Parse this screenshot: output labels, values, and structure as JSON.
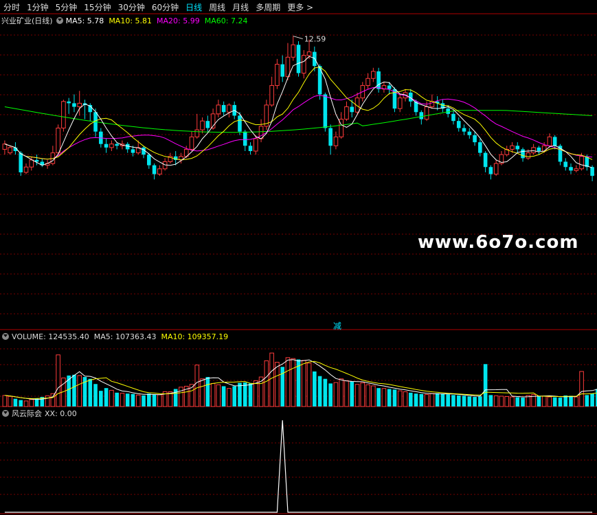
{
  "tabs": [
    "分时",
    "1分钟",
    "5分钟",
    "15分钟",
    "30分钟",
    "60分钟",
    "日线",
    "周线",
    "月线",
    "多周期",
    "更多 >"
  ],
  "active_tab": "日线",
  "colors": {
    "up": "#ff3c3c",
    "down": "#00e5ee",
    "ma5": "#ffffff",
    "ma10": "#ffff00",
    "ma20": "#ff00ff",
    "ma60": "#00ff00",
    "grid": "#7a0000",
    "border": "#b00000"
  },
  "main_panel": {
    "title": "兴业矿业(日线)",
    "indicators": [
      {
        "label": "MA5: 5.78",
        "color": "#ffffff"
      },
      {
        "label": "MA10: 5.81",
        "color": "#ffff00"
      },
      {
        "label": "MA20: 5.99",
        "color": "#ff00ff"
      },
      {
        "label": "MA60: 7.24",
        "color": "#00ff00"
      }
    ],
    "high_label": "12.59"
  },
  "volume_panel": {
    "indicators": [
      {
        "label": "VOLUME: 124535.40",
        "color": "#dddddd"
      },
      {
        "label": "MA5: 107363.43",
        "color": "#dddddd"
      },
      {
        "label": "MA10: 109357.19",
        "color": "#ffff00"
      }
    ],
    "marker": "减"
  },
  "indicator_panel": {
    "title": "风云际会",
    "value_label": "XX: 0.00"
  },
  "watermark": "www.6o7o.com",
  "chart_data": {
    "type": "candlestick",
    "price_range": [
      3.0,
      13.0
    ],
    "candles": [
      {
        "o": 6.2,
        "c": 6.5,
        "h": 6.7,
        "l": 5.9
      },
      {
        "o": 6.0,
        "c": 6.3,
        "h": 6.4,
        "l": 5.9
      },
      {
        "o": 6.3,
        "c": 6.1,
        "h": 6.6,
        "l": 5.9
      },
      {
        "o": 6.0,
        "c": 4.9,
        "h": 6.1,
        "l": 4.7
      },
      {
        "o": 4.9,
        "c": 5.2,
        "h": 5.4,
        "l": 4.8
      },
      {
        "o": 5.2,
        "c": 5.6,
        "h": 5.8,
        "l": 5.0
      },
      {
        "o": 5.6,
        "c": 5.5,
        "h": 5.9,
        "l": 5.3
      },
      {
        "o": 5.5,
        "c": 5.3,
        "h": 5.7,
        "l": 5.2
      },
      {
        "o": 5.3,
        "c": 5.4,
        "h": 5.6,
        "l": 5.1
      },
      {
        "o": 5.4,
        "c": 6.0,
        "h": 6.4,
        "l": 5.3
      },
      {
        "o": 6.0,
        "c": 7.4,
        "h": 7.6,
        "l": 5.9
      },
      {
        "o": 7.4,
        "c": 8.9,
        "h": 9.0,
        "l": 7.2
      },
      {
        "o": 8.9,
        "c": 8.8,
        "h": 9.1,
        "l": 8.2
      },
      {
        "o": 8.8,
        "c": 8.6,
        "h": 9.3,
        "l": 8.3
      },
      {
        "o": 8.6,
        "c": 8.8,
        "h": 9.5,
        "l": 8.1
      },
      {
        "o": 8.8,
        "c": 8.7,
        "h": 9.0,
        "l": 7.9
      },
      {
        "o": 8.7,
        "c": 8.3,
        "h": 8.8,
        "l": 7.8
      },
      {
        "o": 8.3,
        "c": 7.2,
        "h": 8.5,
        "l": 6.9
      },
      {
        "o": 7.2,
        "c": 6.5,
        "h": 7.4,
        "l": 6.3
      },
      {
        "o": 6.5,
        "c": 6.3,
        "h": 6.8,
        "l": 6.0
      },
      {
        "o": 6.3,
        "c": 6.5,
        "h": 6.7,
        "l": 6.1
      },
      {
        "o": 6.5,
        "c": 6.4,
        "h": 6.6,
        "l": 6.2
      },
      {
        "o": 6.4,
        "c": 6.5,
        "h": 6.7,
        "l": 6.2
      },
      {
        "o": 6.5,
        "c": 6.2,
        "h": 6.6,
        "l": 6.0
      },
      {
        "o": 6.2,
        "c": 6.0,
        "h": 6.4,
        "l": 5.8
      },
      {
        "o": 6.0,
        "c": 6.3,
        "h": 6.7,
        "l": 5.9
      },
      {
        "o": 6.3,
        "c": 5.9,
        "h": 6.4,
        "l": 5.7
      },
      {
        "o": 5.9,
        "c": 5.3,
        "h": 6.0,
        "l": 5.1
      },
      {
        "o": 5.3,
        "c": 4.8,
        "h": 5.4,
        "l": 4.5
      },
      {
        "o": 4.8,
        "c": 5.1,
        "h": 5.3,
        "l": 4.7
      },
      {
        "o": 5.1,
        "c": 5.5,
        "h": 5.7,
        "l": 5.0
      },
      {
        "o": 5.5,
        "c": 5.8,
        "h": 6.0,
        "l": 5.4
      },
      {
        "o": 5.8,
        "c": 5.6,
        "h": 6.1,
        "l": 5.3
      },
      {
        "o": 5.6,
        "c": 5.8,
        "h": 6.0,
        "l": 5.4
      },
      {
        "o": 5.8,
        "c": 6.2,
        "h": 6.4,
        "l": 5.7
      },
      {
        "o": 6.2,
        "c": 6.9,
        "h": 7.2,
        "l": 6.1
      },
      {
        "o": 6.9,
        "c": 7.3,
        "h": 8.2,
        "l": 6.8
      },
      {
        "o": 7.3,
        "c": 7.8,
        "h": 8.0,
        "l": 7.1
      },
      {
        "o": 7.8,
        "c": 7.4,
        "h": 8.1,
        "l": 7.2
      },
      {
        "o": 7.4,
        "c": 8.2,
        "h": 8.5,
        "l": 7.3
      },
      {
        "o": 8.2,
        "c": 8.7,
        "h": 9.0,
        "l": 8.0
      },
      {
        "o": 8.7,
        "c": 8.3,
        "h": 8.9,
        "l": 8.1
      },
      {
        "o": 8.3,
        "c": 8.7,
        "h": 8.8,
        "l": 8.0
      },
      {
        "o": 8.7,
        "c": 8.1,
        "h": 8.9,
        "l": 7.9
      },
      {
        "o": 8.1,
        "c": 7.2,
        "h": 8.3,
        "l": 7.0
      },
      {
        "o": 7.2,
        "c": 6.4,
        "h": 7.3,
        "l": 6.1
      },
      {
        "o": 6.4,
        "c": 6.1,
        "h": 6.6,
        "l": 5.9
      },
      {
        "o": 6.1,
        "c": 6.8,
        "h": 7.0,
        "l": 5.9
      },
      {
        "o": 6.8,
        "c": 7.5,
        "h": 7.9,
        "l": 6.6
      },
      {
        "o": 7.5,
        "c": 8.7,
        "h": 9.0,
        "l": 7.3
      },
      {
        "o": 8.7,
        "c": 9.8,
        "h": 10.3,
        "l": 8.6
      },
      {
        "o": 9.8,
        "c": 11.0,
        "h": 11.3,
        "l": 9.6
      },
      {
        "o": 11.0,
        "c": 10.3,
        "h": 11.5,
        "l": 10.0
      },
      {
        "o": 10.3,
        "c": 11.4,
        "h": 12.2,
        "l": 10.1
      },
      {
        "o": 11.4,
        "c": 12.1,
        "h": 12.59,
        "l": 11.2
      },
      {
        "o": 12.1,
        "c": 10.5,
        "h": 12.3,
        "l": 10.3
      },
      {
        "o": 10.5,
        "c": 11.5,
        "h": 11.8,
        "l": 10.2
      },
      {
        "o": 11.5,
        "c": 11.7,
        "h": 12.4,
        "l": 11.3
      },
      {
        "o": 11.7,
        "c": 10.9,
        "h": 12.0,
        "l": 10.6
      },
      {
        "o": 10.9,
        "c": 9.3,
        "h": 11.0,
        "l": 9.0
      },
      {
        "o": 9.3,
        "c": 7.4,
        "h": 9.4,
        "l": 7.2
      },
      {
        "o": 7.4,
        "c": 6.4,
        "h": 7.6,
        "l": 5.9
      },
      {
        "o": 6.4,
        "c": 6.9,
        "h": 7.2,
        "l": 6.2
      },
      {
        "o": 6.9,
        "c": 7.9,
        "h": 8.3,
        "l": 6.8
      },
      {
        "o": 7.9,
        "c": 8.6,
        "h": 8.9,
        "l": 7.8
      },
      {
        "o": 8.6,
        "c": 8.3,
        "h": 9.0,
        "l": 8.0
      },
      {
        "o": 8.3,
        "c": 9.1,
        "h": 9.4,
        "l": 8.2
      },
      {
        "o": 9.1,
        "c": 9.8,
        "h": 10.0,
        "l": 8.9
      },
      {
        "o": 9.8,
        "c": 10.2,
        "h": 10.5,
        "l": 9.6
      },
      {
        "o": 10.2,
        "c": 10.6,
        "h": 10.8,
        "l": 10.0
      },
      {
        "o": 10.6,
        "c": 9.6,
        "h": 10.8,
        "l": 9.4
      },
      {
        "o": 9.6,
        "c": 9.8,
        "h": 10.0,
        "l": 9.4
      },
      {
        "o": 9.8,
        "c": 9.6,
        "h": 10.0,
        "l": 9.3
      },
      {
        "o": 9.6,
        "c": 8.5,
        "h": 9.7,
        "l": 8.3
      },
      {
        "o": 8.5,
        "c": 9.1,
        "h": 9.3,
        "l": 8.3
      },
      {
        "o": 9.1,
        "c": 9.4,
        "h": 9.6,
        "l": 8.9
      },
      {
        "o": 9.4,
        "c": 8.9,
        "h": 9.6,
        "l": 8.6
      },
      {
        "o": 8.9,
        "c": 8.3,
        "h": 9.0,
        "l": 8.1
      },
      {
        "o": 8.3,
        "c": 7.9,
        "h": 8.4,
        "l": 7.6
      },
      {
        "o": 7.9,
        "c": 8.6,
        "h": 8.9,
        "l": 7.8
      },
      {
        "o": 8.6,
        "c": 8.9,
        "h": 9.3,
        "l": 8.5
      },
      {
        "o": 8.9,
        "c": 8.8,
        "h": 9.2,
        "l": 8.4
      },
      {
        "o": 8.8,
        "c": 8.5,
        "h": 9.0,
        "l": 8.3
      },
      {
        "o": 8.5,
        "c": 8.2,
        "h": 8.7,
        "l": 8.0
      },
      {
        "o": 8.2,
        "c": 7.8,
        "h": 8.4,
        "l": 7.6
      },
      {
        "o": 7.8,
        "c": 7.4,
        "h": 8.0,
        "l": 7.2
      },
      {
        "o": 7.4,
        "c": 7.2,
        "h": 7.6,
        "l": 7.0
      },
      {
        "o": 7.2,
        "c": 7.0,
        "h": 7.4,
        "l": 6.8
      },
      {
        "o": 7.0,
        "c": 6.6,
        "h": 7.2,
        "l": 6.4
      },
      {
        "o": 6.6,
        "c": 6.0,
        "h": 6.8,
        "l": 5.8
      },
      {
        "o": 6.0,
        "c": 5.2,
        "h": 6.1,
        "l": 4.9
      },
      {
        "o": 5.2,
        "c": 4.8,
        "h": 5.3,
        "l": 4.5
      },
      {
        "o": 4.8,
        "c": 5.4,
        "h": 5.6,
        "l": 4.7
      },
      {
        "o": 5.4,
        "c": 5.9,
        "h": 6.1,
        "l": 5.3
      },
      {
        "o": 5.9,
        "c": 6.2,
        "h": 6.4,
        "l": 5.8
      },
      {
        "o": 6.2,
        "c": 6.4,
        "h": 6.6,
        "l": 6.0
      },
      {
        "o": 6.4,
        "c": 6.2,
        "h": 6.6,
        "l": 6.0
      },
      {
        "o": 6.2,
        "c": 5.7,
        "h": 6.3,
        "l": 5.5
      },
      {
        "o": 5.7,
        "c": 6.0,
        "h": 6.2,
        "l": 5.6
      },
      {
        "o": 6.0,
        "c": 6.3,
        "h": 6.5,
        "l": 5.9
      },
      {
        "o": 6.3,
        "c": 6.1,
        "h": 6.4,
        "l": 5.9
      },
      {
        "o": 6.1,
        "c": 6.4,
        "h": 6.6,
        "l": 6.0
      },
      {
        "o": 6.4,
        "c": 6.9,
        "h": 7.1,
        "l": 6.3
      },
      {
        "o": 6.9,
        "c": 6.4,
        "h": 7.0,
        "l": 6.2
      },
      {
        "o": 6.4,
        "c": 5.5,
        "h": 6.5,
        "l": 5.3
      },
      {
        "o": 5.5,
        "c": 5.2,
        "h": 5.7,
        "l": 5.0
      },
      {
        "o": 5.2,
        "c": 5.0,
        "h": 5.4,
        "l": 4.8
      },
      {
        "o": 5.0,
        "c": 5.1,
        "h": 5.3,
        "l": 4.9
      },
      {
        "o": 5.1,
        "c": 5.8,
        "h": 6.0,
        "l": 5.0
      },
      {
        "o": 5.8,
        "c": 5.2,
        "h": 5.9,
        "l": 5.0
      },
      {
        "o": 5.2,
        "c": 4.7,
        "h": 5.3,
        "l": 4.4
      }
    ],
    "volume_range": [
      0,
      350000
    ],
    "volumes": [
      60000,
      55000,
      42000,
      35000,
      30000,
      38000,
      45000,
      52000,
      58000,
      70000,
      280000,
      155000,
      168000,
      172000,
      168000,
      160000,
      150000,
      122000,
      85000,
      100000,
      88000,
      75000,
      72000,
      70000,
      68000,
      62000,
      60000,
      70000,
      66000,
      64000,
      80000,
      80000,
      95000,
      105000,
      110000,
      120000,
      225000,
      150000,
      160000,
      125000,
      118000,
      110000,
      98000,
      110000,
      128000,
      130000,
      125000,
      140000,
      160000,
      248000,
      290000,
      240000,
      215000,
      265000,
      260000,
      255000,
      250000,
      235000,
      190000,
      165000,
      150000,
      125000,
      130000,
      150000,
      140000,
      135000,
      120000,
      128000,
      118000,
      112000,
      100000,
      98000,
      95000,
      92000,
      85000,
      80000,
      75000,
      70000,
      68000,
      65000,
      70000,
      72000,
      68000,
      66000,
      62000,
      60000,
      58000,
      55000,
      52000,
      55000,
      230000,
      62000,
      58000,
      56000,
      54000,
      52000,
      50000,
      48000,
      60000,
      65000,
      58000,
      56000,
      52000,
      50000,
      48000,
      60000,
      58000,
      52000,
      190000,
      62000,
      70000,
      95000,
      125000
    ],
    "xx_values_note": "spike to 1 at candle 52, else 0",
    "xx_spike_index": 52
  }
}
